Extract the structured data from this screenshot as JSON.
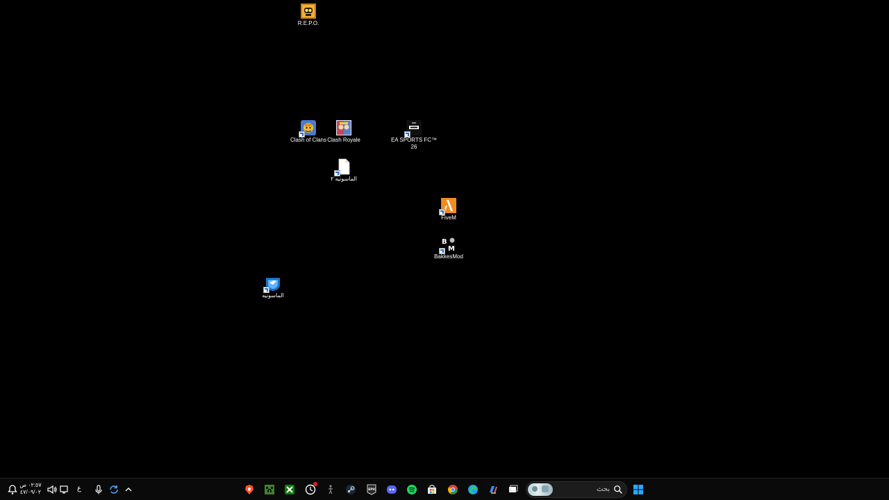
{
  "desktop": {
    "icons": [
      {
        "label": "R.E.P.O.",
        "icon": "repo-game-icon",
        "shortcut": false
      },
      {
        "label": "Clash of Clans",
        "icon": "clash-of-clans-icon",
        "shortcut": true
      },
      {
        "label": "Clash Royale",
        "icon": "clash-royale-icon",
        "shortcut": false
      },
      {
        "label": "EA SPORTS FC™ 26",
        "icon": "ea-sports-fc-icon",
        "shortcut": true
      },
      {
        "label": "الماسونيه ٢",
        "icon": "file-icon",
        "shortcut": true
      },
      {
        "label": "FiveM",
        "icon": "fivem-icon",
        "shortcut": true
      },
      {
        "label": "BakkesMod",
        "icon": "bakkesmod-icon",
        "shortcut": true
      },
      {
        "label": "الماسونيه",
        "icon": "rocket-league-icon",
        "shortcut": true
      }
    ]
  },
  "taskbar": {
    "clock": {
      "time": "٠٢:٥٧ ص",
      "date": "٤٧/٠٩/٠٢"
    },
    "language": "ع",
    "search": {
      "placeholder": "بحث"
    },
    "apps": [
      {
        "name": "brave-browser-icon"
      },
      {
        "name": "minecraft-icon"
      },
      {
        "name": "xbox-icon"
      },
      {
        "name": "circle-app-icon"
      },
      {
        "name": "figure-app-icon"
      },
      {
        "name": "steam-icon"
      },
      {
        "name": "epic-games-icon"
      },
      {
        "name": "discord-icon"
      },
      {
        "name": "spotify-icon"
      },
      {
        "name": "microsoft-store-icon"
      },
      {
        "name": "chrome-icon"
      },
      {
        "name": "edge-icon"
      },
      {
        "name": "copilot-icon"
      },
      {
        "name": "task-view-icon"
      }
    ],
    "colors": {
      "windows_logo": "#29a8ff",
      "spotify": "#1ed760",
      "discord": "#5865f2",
      "brave": "#fb542b",
      "xbox": "#107c10",
      "minecraft": "#3c8527"
    }
  }
}
